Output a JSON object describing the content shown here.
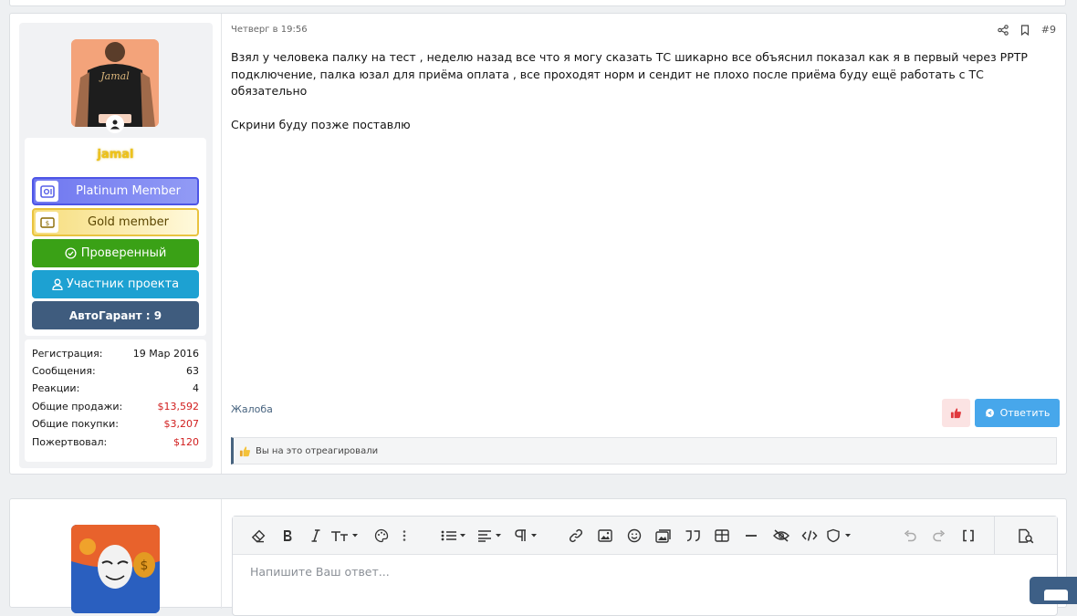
{
  "post": {
    "date": "Четверг в 19:56",
    "number": "#9",
    "text_lines": [
      "Взял у человека палку на тест , неделю назад все что я могу сказать ТС шикарно все объяснил показал как я в первый через PPTP",
      "подключение, палка юзал для приёма оплата , все проходят норм и сендит не плохо после приёма буду ещё работать с ТС обязательно",
      "",
      "Скрини буду позже поставлю"
    ],
    "report_label": "Жалоба",
    "reply_label": "Ответить",
    "reactions_text": "Вы на это отреагировали"
  },
  "user": {
    "name": "jamal",
    "roles": {
      "platinum": "Platinum Member",
      "gold": "Gold member",
      "verified": "Проверенный",
      "member": "Участник проекта",
      "garant": "АвтоГарант : 9"
    },
    "stats": [
      {
        "label": "Регистрация:",
        "value": "19 Мар 2016",
        "red": false
      },
      {
        "label": "Сообщения:",
        "value": "63",
        "red": false
      },
      {
        "label": "Реакции:",
        "value": "4",
        "red": false
      },
      {
        "label": "Общие продажи:",
        "value": "$13,592",
        "red": true
      },
      {
        "label": "Общие покупки:",
        "value": "$3,207",
        "red": true
      },
      {
        "label": "Пожертвовал:",
        "value": "$120",
        "red": true
      }
    ]
  },
  "editor": {
    "placeholder": "Напишите Ваш ответ..."
  },
  "colors": {
    "accent": "#47a7eb",
    "platinum": "#6f77f0",
    "gold": "#f6dd7c",
    "verified": "#3aa116",
    "member": "#1da1d2",
    "garant": "#3f5c7e",
    "money_red": "#d11d1d"
  }
}
